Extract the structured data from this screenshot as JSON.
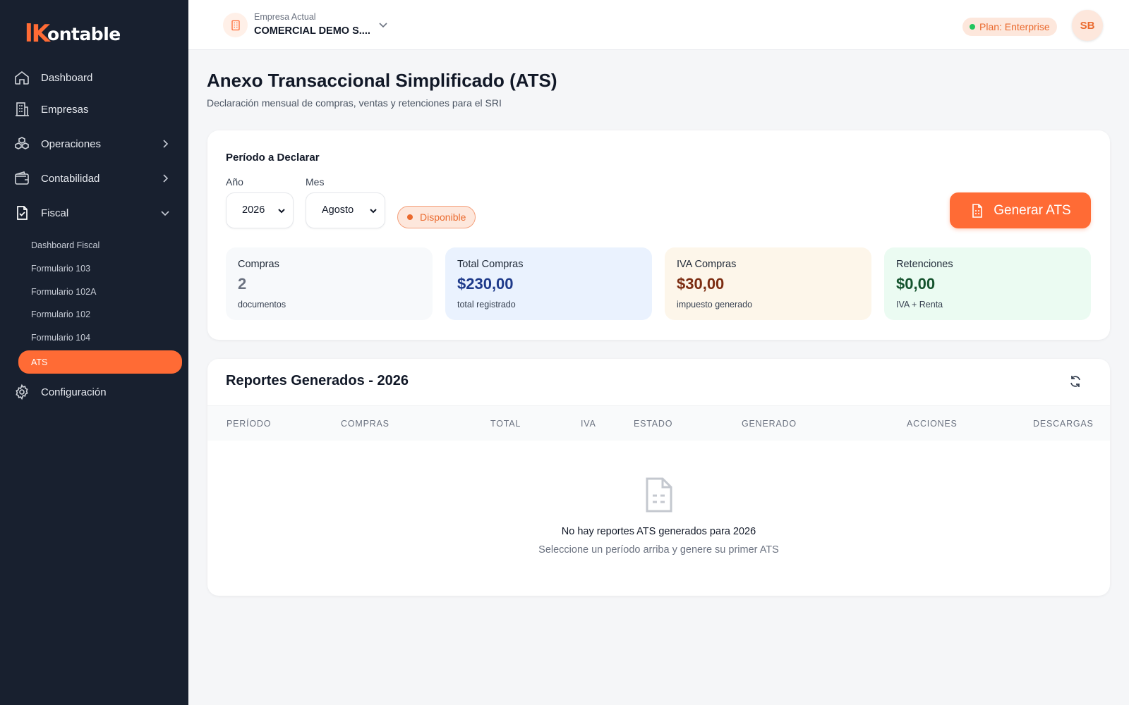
{
  "brand": {
    "mark": "lK",
    "text": "ontable"
  },
  "sidebar": {
    "items": [
      {
        "label": "Dashboard",
        "icon": "home-icon"
      },
      {
        "label": "Empresas",
        "icon": "building-icon"
      },
      {
        "label": "Operaciones",
        "icon": "cubes-icon"
      },
      {
        "label": "Contabilidad",
        "icon": "wallet-icon"
      },
      {
        "label": "Fiscal",
        "icon": "document-check-icon"
      },
      {
        "label": "Configuración",
        "icon": "gear-icon"
      }
    ],
    "fiscal_sub": [
      {
        "label": "Dashboard Fiscal"
      },
      {
        "label": "Formulario 103"
      },
      {
        "label": "Formulario 102A"
      },
      {
        "label": "Formulario 102"
      },
      {
        "label": "Formulario 104"
      },
      {
        "label": "ATS"
      }
    ]
  },
  "topbar": {
    "company_label": "Empresa Actual",
    "company_name": "COMERCIAL DEMO S....",
    "plan": "Plan: Enterprise",
    "avatar": "SB"
  },
  "page": {
    "title": "Anexo Transaccional Simplificado (ATS)",
    "subtitle": "Declaración mensual de compras, ventas y retenciones para el SRI"
  },
  "period": {
    "title": "Período a Declarar",
    "year_label": "Año",
    "year_value": "2026",
    "month_label": "Mes",
    "month_value": "Agosto",
    "status": "Disponible",
    "generate_label": "Generar ATS"
  },
  "stats": [
    {
      "title": "Compras",
      "value": "2",
      "sub": "documentos",
      "bg": "#f7f9fb",
      "color": "#6b7280"
    },
    {
      "title": "Total Compras",
      "value": "$230,00",
      "sub": "total registrado",
      "bg": "#eaf2fe",
      "color": "#1e3a8a"
    },
    {
      "title": "IVA Compras",
      "value": "$30,00",
      "sub": "impuesto generado",
      "bg": "#fdf6ea",
      "color": "#7c2d12"
    },
    {
      "title": "Retenciones",
      "value": "$0,00",
      "sub": "IVA + Renta",
      "bg": "#ebfbf2",
      "color": "#14532d"
    }
  ],
  "reports": {
    "title": "Reportes Generados - 2026",
    "columns": [
      "PERÍODO",
      "COMPRAS",
      "TOTAL",
      "IVA",
      "ESTADO",
      "GENERADO",
      "ACCIONES",
      "DESCARGAS"
    ],
    "empty_title": "No hay reportes ATS generados para 2026",
    "empty_sub": "Seleccione un período arriba y genere su primer ATS"
  },
  "colors": {
    "accent": "#ff6b35",
    "sidebar": "#18202f"
  }
}
